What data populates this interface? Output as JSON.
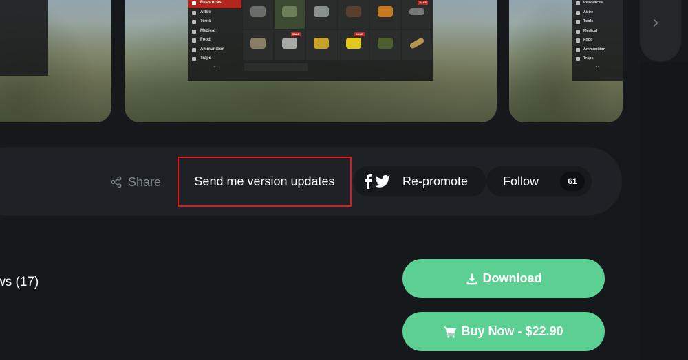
{
  "carousel": {
    "categories": [
      "Resources",
      "Attire",
      "Tools",
      "Medical",
      "Food",
      "Ammunition",
      "Traps"
    ],
    "sale_badge": "SALE",
    "next_icon": "chevron-right-icon"
  },
  "actions": {
    "share_label": "Share",
    "version_updates_label": "Send me version updates",
    "repromote_label": "Re-promote",
    "follow_label": "Follow",
    "follow_count": "61"
  },
  "content": {
    "reviews_label": "ws (17)"
  },
  "purchase": {
    "download_label": "Download",
    "buy_label": "Buy Now - $22.90"
  },
  "colors": {
    "accent_green": "#5ccf93",
    "highlight_red": "#e8161b",
    "background": "#16191c"
  }
}
